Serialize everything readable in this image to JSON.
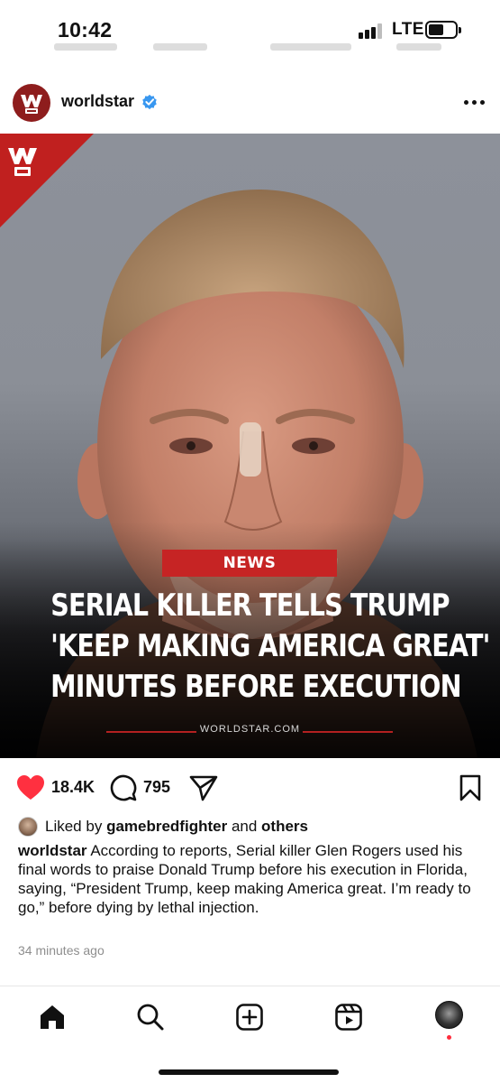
{
  "status_bar": {
    "time": "10:42",
    "network": "LTE"
  },
  "post": {
    "username": "worldstar",
    "verified": true,
    "image": {
      "news_tag": "NEWS",
      "headline_lines": [
        "SERIAL KILLER TELLS TRUMP",
        "'KEEP MAKING AMERICA GREAT'",
        "MINUTES BEFORE EXECUTION"
      ],
      "site": "WORLDSTAR.COM",
      "logo_text": "WS"
    },
    "actions": {
      "likes": "18.4K",
      "comments": "795"
    },
    "liked_by": {
      "prefix": "Liked by",
      "user": "gamebredfighter",
      "connector": "and",
      "others": "others"
    },
    "caption": {
      "username": "worldstar",
      "text": "According to reports, Serial killer Glen Rogers used his final words to praise Donald Trump before his execution in Florida, saying, “President Trump, keep making America great. I’m ready to go,” before dying by lethal injection."
    },
    "time_ago": "34 minutes ago"
  },
  "icons": {
    "like": "heart-icon",
    "comment": "comment-icon",
    "share": "send-icon",
    "save": "bookmark-icon",
    "more": "more-icon",
    "verified": "verified-icon"
  },
  "nav": {
    "items": [
      "home",
      "search",
      "create",
      "reels",
      "profile"
    ]
  },
  "colors": {
    "like_red": "#ff3040",
    "brand_red": "#c0201f",
    "verified_blue": "#3897f0",
    "muted": "#8e8e8e"
  }
}
